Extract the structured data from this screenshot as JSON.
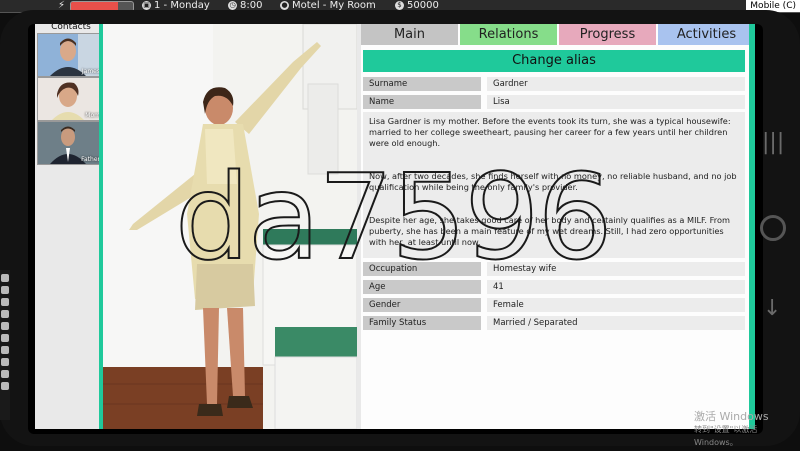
{
  "topbar": {
    "energy_fraction": 0.75,
    "day": "1 - Monday",
    "time": "8:00",
    "location": "Motel - My Room",
    "money": "50000",
    "mode": "Mobile (C)"
  },
  "contacts": {
    "title": "Contacts",
    "items": [
      {
        "name": "James"
      },
      {
        "name": "Mom"
      },
      {
        "name": "Father"
      }
    ]
  },
  "tabs": [
    {
      "label": "Main",
      "color": "#c4c4c4"
    },
    {
      "label": "Relations",
      "color": "#86dd8a"
    },
    {
      "label": "Progress",
      "color": "#e7a9bc"
    },
    {
      "label": "Activities",
      "color": "#a9c3ef"
    }
  ],
  "profile": {
    "change_alias": "Change alias",
    "surname_label": "Surname",
    "surname": "Gardner",
    "name_label": "Name",
    "name": "Lisa",
    "bio": [
      "Lisa Gardner is my mother. Before the events took its turn, she was a typical housewife: married to her college sweetheart, pausing her career for a few years until her children were old enough.",
      "Now, after two decades, she finds herself with no money, no reliable husband, and no job qualification while being the only family's provider.",
      "Despite her age, she takes good care of her body and certainly qualifies as a MILF. From puberty, she has been a main feature of my wet dreams. Still, I had zero opportunities with her, at least until now."
    ],
    "occupation_label": "Occupation",
    "occupation": "Homestay wife",
    "age_label": "Age",
    "age": "41",
    "gender_label": "Gender",
    "gender": "Female",
    "family_status_label": "Family Status",
    "family_status": "Married / Separated"
  },
  "watermark": "da7596",
  "windows_notice": {
    "title": "激活 Windows",
    "subtitle": "转到\"设置\"以激活 Windows。"
  }
}
